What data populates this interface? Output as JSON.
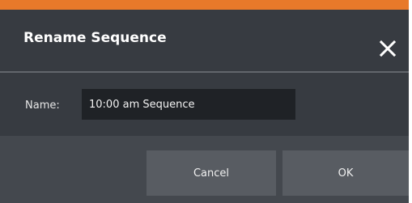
{
  "dialog": {
    "title": "Rename Sequence",
    "accent_color": "#e8792a",
    "close_icon": "close-icon"
  },
  "form": {
    "name_label": "Name:",
    "name_value": "10:00 am Sequence"
  },
  "buttons": {
    "cancel_label": "Cancel",
    "ok_label": "OK"
  }
}
